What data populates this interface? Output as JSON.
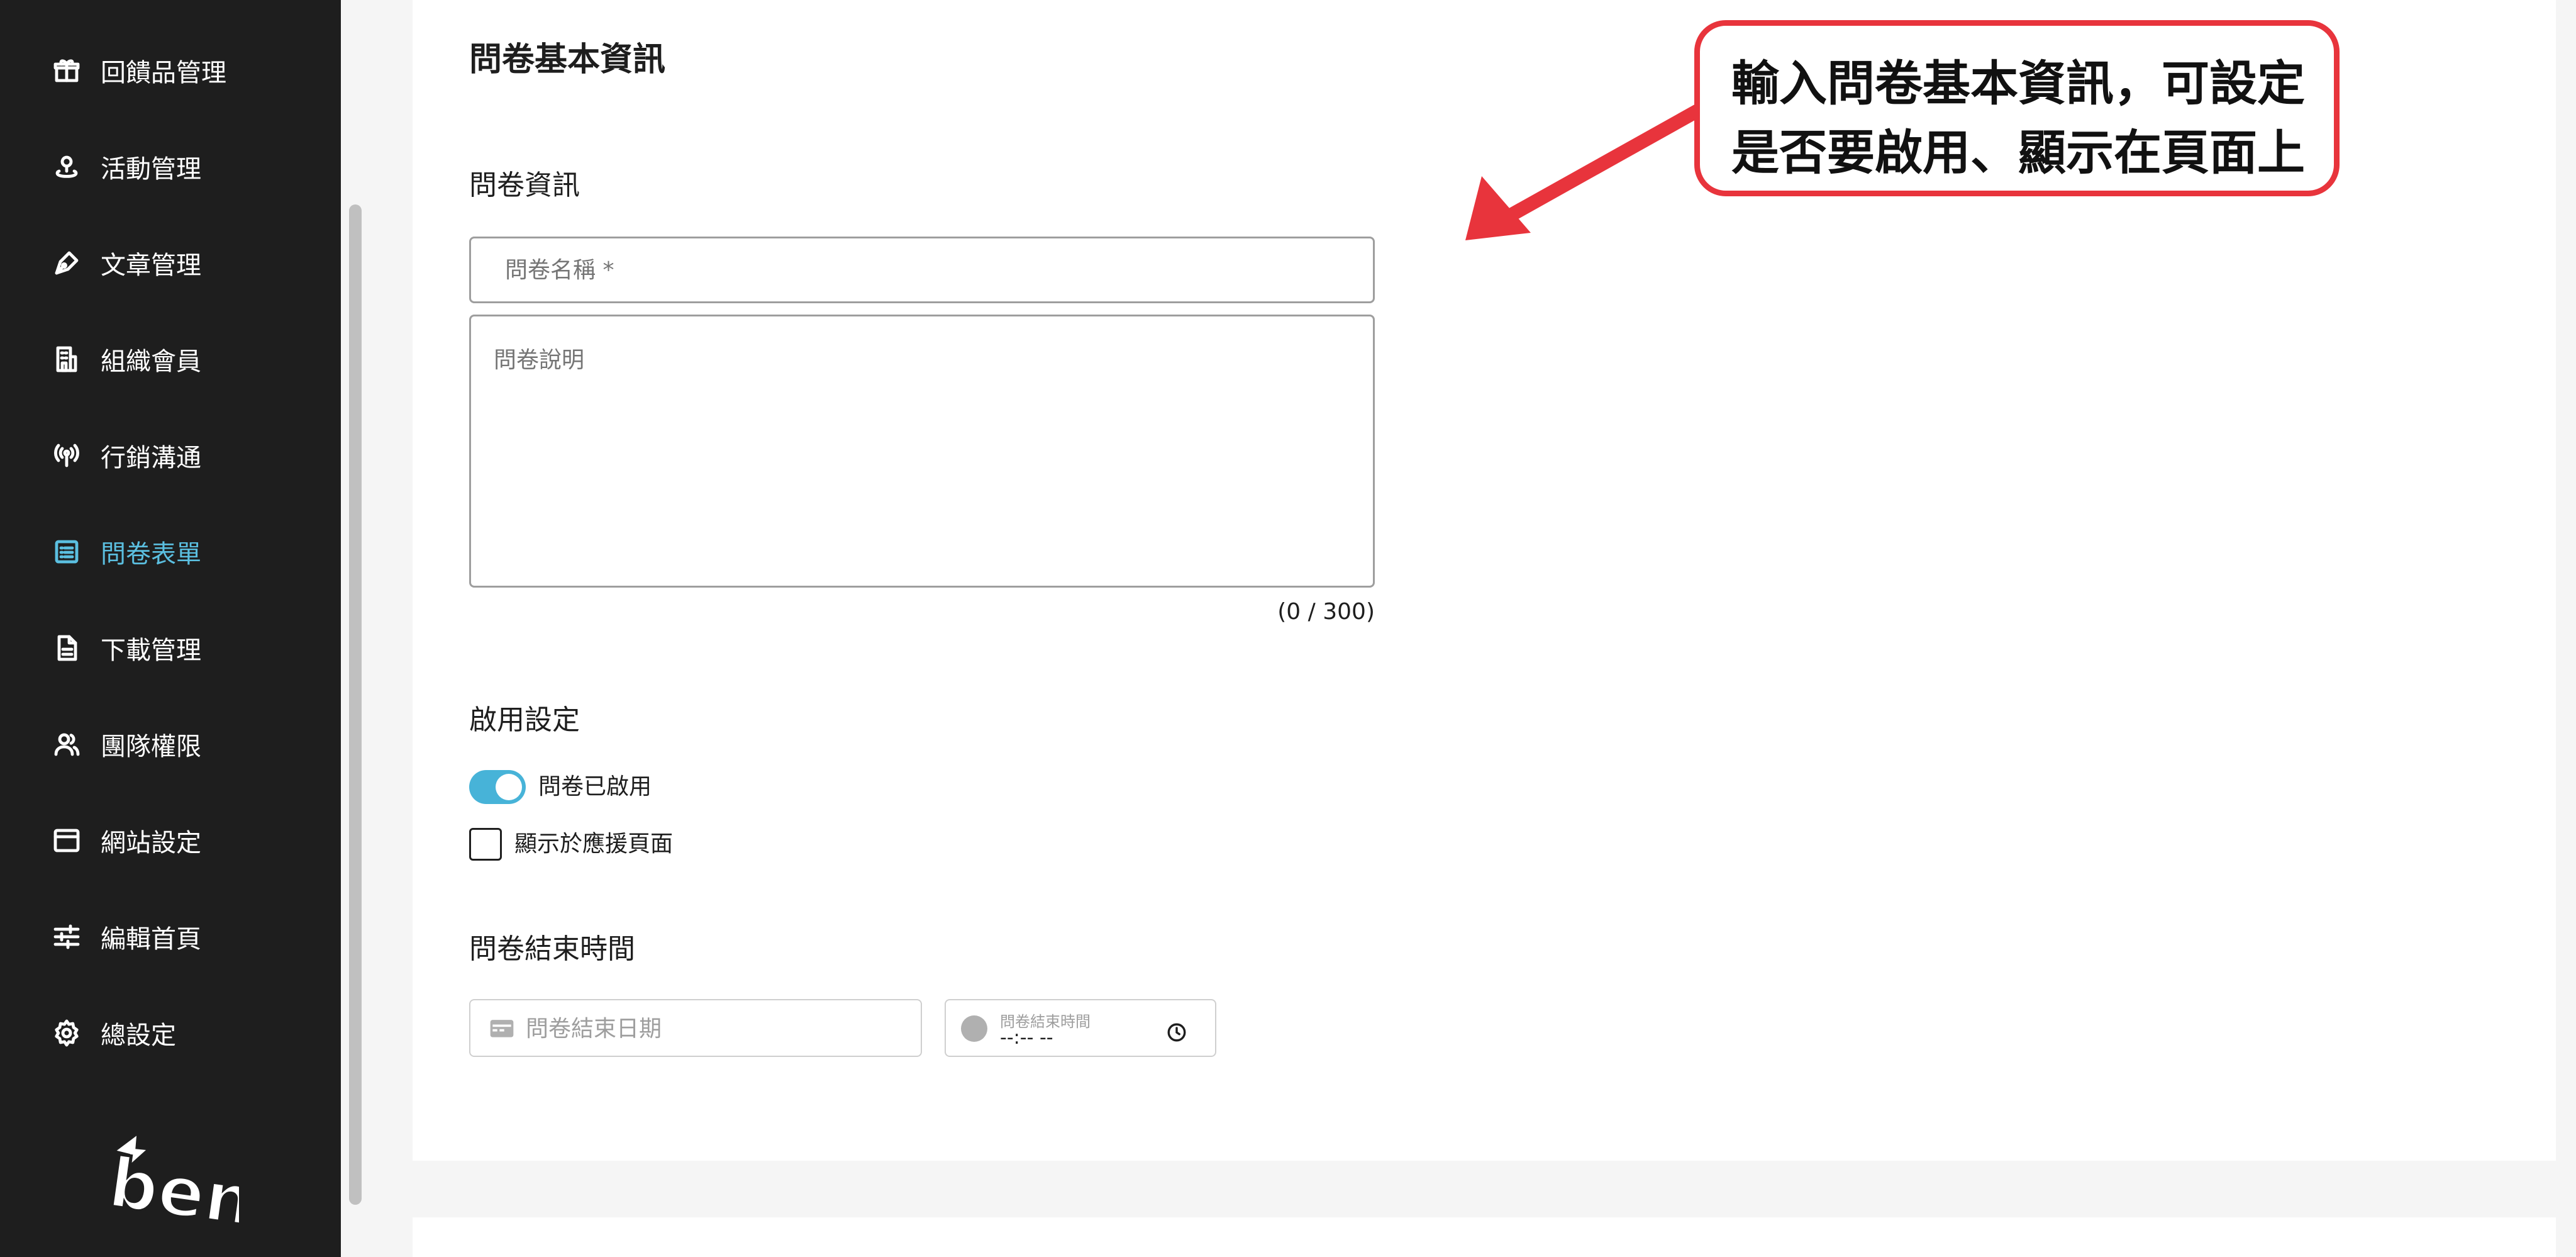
{
  "sidebar": {
    "items": [
      {
        "label": "回饋品管理",
        "icon": "gift-icon"
      },
      {
        "label": "活動管理",
        "icon": "location-icon"
      },
      {
        "label": "文章管理",
        "icon": "pen-icon"
      },
      {
        "label": "組織會員",
        "icon": "building-icon"
      },
      {
        "label": "行銷溝通",
        "icon": "broadcast-icon"
      },
      {
        "label": "問卷表單",
        "icon": "list-icon",
        "active": true
      },
      {
        "label": "下載管理",
        "icon": "document-icon"
      },
      {
        "label": "團隊權限",
        "icon": "users-icon"
      },
      {
        "label": "網站設定",
        "icon": "browser-icon"
      },
      {
        "label": "編輯首頁",
        "icon": "sliders-icon"
      },
      {
        "label": "總設定",
        "icon": "gear-icon"
      }
    ],
    "logo_text": "ben",
    "active_color": "#5bbfe0"
  },
  "form": {
    "title": "問卷基本資訊",
    "info_heading": "問卷資訊",
    "name_placeholder": "問卷名稱 *",
    "description_placeholder": "問卷說明",
    "char_counter": "(0 / 300)",
    "enable_heading": "啟用設定",
    "enabled_toggle_label": "問卷已啟用",
    "enabled": true,
    "show_checkbox_label": "顯示於應援頁面",
    "show_checked": false,
    "end_heading": "問卷結束時間",
    "end_date_placeholder": "問卷結束日期",
    "end_time_label": "問卷結束時間",
    "end_time_value": "--:-- --",
    "toggle_color": "#47b3d8"
  },
  "annotation": {
    "line1": "輸入問卷基本資訊，可設定",
    "line2": "是否要啟用、顯示在頁面上",
    "color": "#e8343c"
  }
}
